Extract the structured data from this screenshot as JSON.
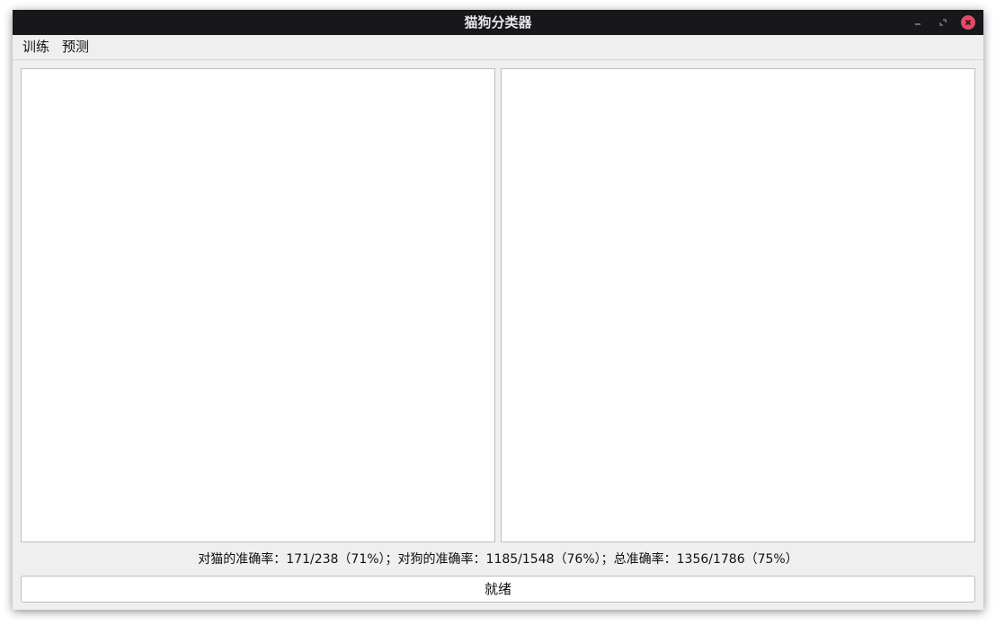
{
  "window": {
    "title": "猫狗分类器"
  },
  "titlebar_buttons": {
    "minimize_icon": "minimize-icon",
    "maximize_icon": "maximize-icon",
    "close_icon": "close-icon",
    "close_color": "#e24a67"
  },
  "menu": {
    "items": [
      {
        "label": "训练"
      },
      {
        "label": "预测"
      }
    ]
  },
  "stats": {
    "text": "对猫的准确率：171/238（71%）；对狗的准确率：1185/1548（76%）；总准确率：1356/1786（75%）"
  },
  "status_button": {
    "label": "就绪"
  },
  "colors": {
    "titlebar": "#17171c",
    "window_bg": "#efefef",
    "panel_bg": "#ffffff"
  }
}
